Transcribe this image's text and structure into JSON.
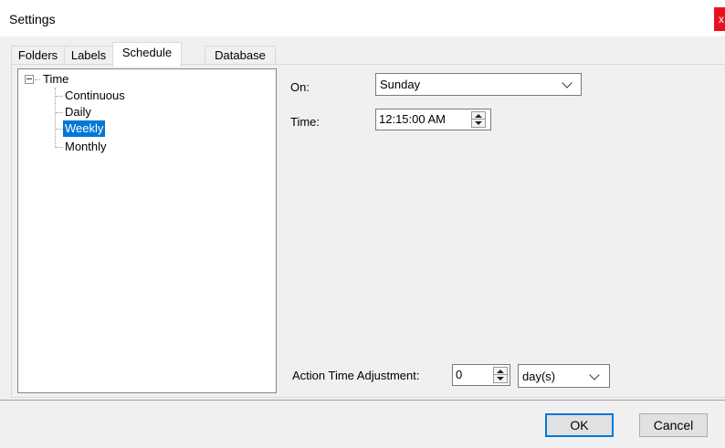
{
  "window": {
    "title": "Settings",
    "close_glyph": "x"
  },
  "tabs": [
    {
      "label": "Folders"
    },
    {
      "label": "Labels"
    },
    {
      "label": "Schedule",
      "active": true
    },
    {
      "label": "Database"
    }
  ],
  "tree": {
    "root": "Time",
    "expander": "minus",
    "children": [
      "Continuous",
      "Daily",
      "Weekly",
      "Monthly"
    ],
    "selected": "Weekly"
  },
  "schedule": {
    "on_label": "On:",
    "on_value": "Sunday",
    "time_label": "Time:",
    "time_value": "12:15:00 AM",
    "adjust_label": "Action Time Adjustment:",
    "adjust_value": "0",
    "adjust_unit": "day(s)"
  },
  "buttons": {
    "ok": "OK",
    "cancel": "Cancel"
  },
  "colors": {
    "selection": "#0078d7",
    "close": "#e81123",
    "dialog_bg": "#f0f0f0"
  }
}
